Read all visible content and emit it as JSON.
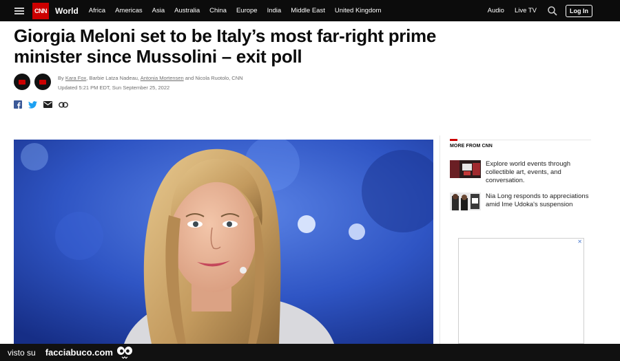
{
  "nav": {
    "logo": "CNN",
    "section": "World",
    "links": [
      "Africa",
      "Americas",
      "Asia",
      "Australia",
      "China",
      "Europe",
      "India",
      "Middle East",
      "United Kingdom"
    ],
    "right_links": [
      "Audio",
      "Live TV"
    ],
    "login_label": "Log In"
  },
  "article": {
    "headline": "Giorgia Meloni set to be Italy’s most far-right prime minister since Mussolini – exit poll",
    "byline": {
      "prefix": "By",
      "author1": "Kara Fox",
      "sep1": ", Barbie Latza Nadeau, ",
      "author3": "Antonia Mortensen",
      "sep2": " and Nicola Ruotolo, CNN"
    },
    "updated": "Updated 5:21 PM EDT, Sun September 25, 2022"
  },
  "rail": {
    "heading": "MORE FROM CNN",
    "items": [
      {
        "text": "Explore world events through collectible art, events, and conversation."
      },
      {
        "text": "Nia Long responds to appreciations amid Ime Udoka's suspension"
      }
    ],
    "ad_close": "✕"
  },
  "footer": {
    "visto": "visto su",
    "site": "facciabuco.com"
  },
  "colors": {
    "accent": "#cc0000",
    "nav_bg": "#0c0c0c",
    "hero_bg": "#2744a8"
  }
}
